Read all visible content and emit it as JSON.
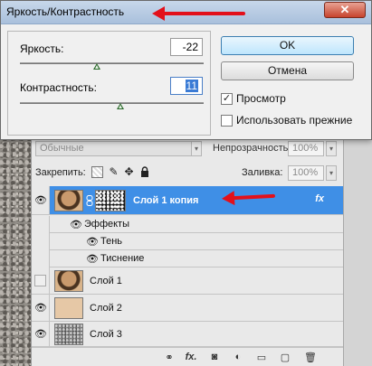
{
  "dialog": {
    "title": "Яркость/Контрастность",
    "close_glyph": "✕",
    "brightness_label": "Яркость:",
    "brightness_value": "-22",
    "contrast_label": "Контрастность:",
    "contrast_value": "11",
    "ok_label": "OK",
    "cancel_label": "Отмена",
    "preview_label": "Просмотр",
    "preview_checked": "✓",
    "legacy_label": "Использовать прежние"
  },
  "layers_panel": {
    "blend_mode": "Обычные",
    "opacity_label": "Непрозрачность:",
    "opacity_value": "100%",
    "lock_label": "Закрепить:",
    "fill_label": "Заливка:",
    "fill_value": "100%",
    "dropdown_glyph": "▾",
    "layers": [
      {
        "name": "Слой 1 копия",
        "fx": "fx",
        "selected": true
      },
      {
        "name": "Слой 1",
        "visible": false
      },
      {
        "name": "Слой 2",
        "visible": true
      },
      {
        "name": "Слой 3",
        "visible": true
      }
    ],
    "effects_label": "Эффекты",
    "effects": [
      "Тень",
      "Тиснение"
    ],
    "bottom_fx": "fx."
  },
  "colors": {
    "selection": "#3f8fe6",
    "arrow": "#e3101a",
    "skin_layer": "#e6c8a6"
  }
}
